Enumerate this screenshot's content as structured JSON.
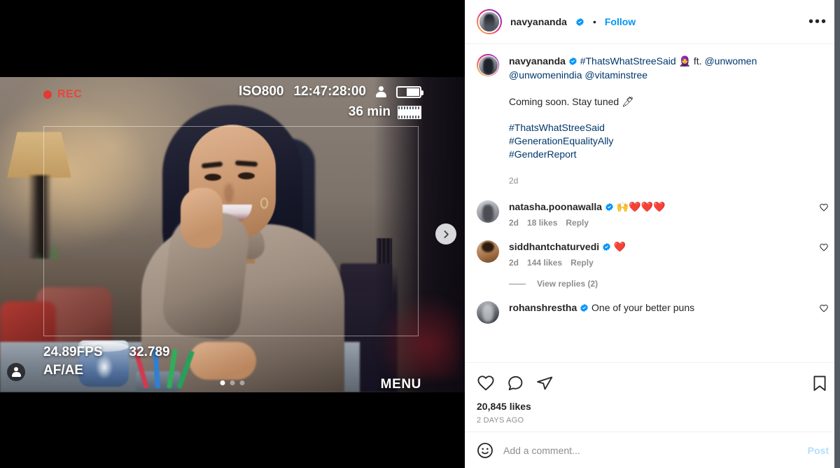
{
  "post": {
    "author": {
      "username": "navyananda",
      "verified": true,
      "separator": "•",
      "follow_label": "Follow",
      "more_label": "•••"
    },
    "caption": {
      "username": "navyananda",
      "line1_tag": "#ThatsWhatStreeSaid",
      "line1_emoji": "🧕",
      "line1_ft": "ft.",
      "line1_mentions": "@unwomen",
      "line2_mentions": "@unwomenindia @vitaminstree",
      "body": "Coming soon. Stay tuned",
      "body_emoji": "🖊",
      "hashtags": [
        "#ThatsWhatStreeSaid",
        "#GenerationEqualityAlly",
        "#GenderReport"
      ],
      "time": "2d"
    },
    "comments": [
      {
        "username": "natasha.poonawalla",
        "verified": true,
        "text": "🙌❤️❤️❤️",
        "time": "2d",
        "likes": "18 likes",
        "reply_label": "Reply",
        "replies_label": null
      },
      {
        "username": "siddhantchaturvedi",
        "verified": true,
        "text": "❤️",
        "time": "2d",
        "likes": "144 likes",
        "reply_label": "Reply",
        "replies_label": "View replies (2)"
      },
      {
        "username": "rohanshrestha",
        "verified": true,
        "text": "One of your better puns",
        "time": "",
        "likes": "",
        "reply_label": "",
        "replies_label": null
      }
    ],
    "actions": {
      "like": "like-icon",
      "comment": "comment-icon",
      "share": "share-icon",
      "save": "save-icon"
    },
    "likes_count": "20,845 likes",
    "posted_ago": "2 DAYS AGO",
    "compose": {
      "placeholder": "Add a comment...",
      "post_label": "Post",
      "emoji_icon": "emoji-icon"
    }
  },
  "media": {
    "carousel": {
      "dots": 3,
      "active_index": 0,
      "next_label": "next-slide"
    },
    "viewfinder": {
      "rec_label": "REC",
      "iso": "ISO800",
      "timecode": "12:47:28:00",
      "duration": "36 min",
      "fps": "24.89FPS",
      "focus_value": "32.789",
      "focus_mode": "AF/AE",
      "menu_label": "MENU"
    },
    "tag_badge": "tagged-people-icon"
  },
  "colors": {
    "accent_blue": "#0095f6",
    "link_blue": "#00376b",
    "muted": "#8e8e8e",
    "text": "#262626",
    "rec_red": "#e8453c",
    "post_disabled": "#b2dffc"
  }
}
